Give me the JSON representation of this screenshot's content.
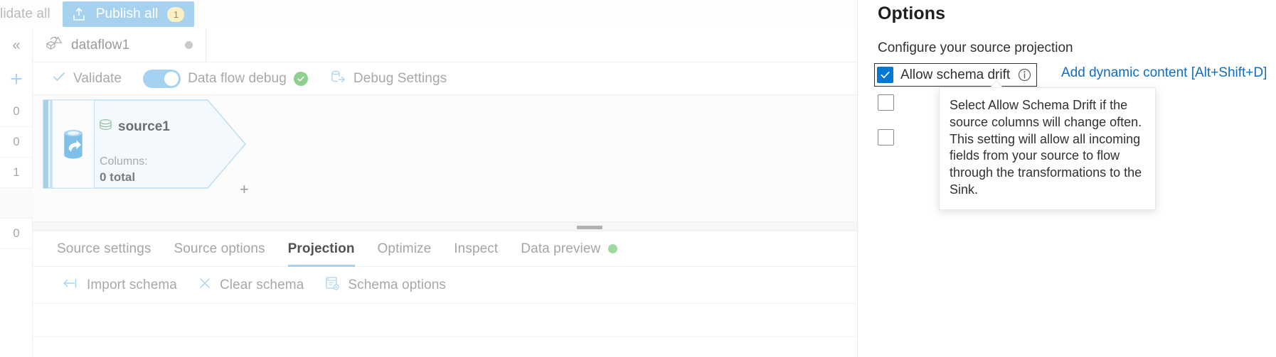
{
  "command_bar": {
    "validate_all_label": "lidate all",
    "publish_all_label": "Publish all",
    "publish_all_badge": "1",
    "publish_icon": "upload-icon"
  },
  "left_rail": {
    "collapse_icon": "chevron-double-left-icon",
    "add_icon": "plus-icon",
    "rows": [
      "0",
      "0",
      "1",
      "",
      "0",
      "",
      ""
    ]
  },
  "dataflow_tab": {
    "label": "dataflow1",
    "icon": "dataflow-icon",
    "status_dot": "unsaved-dot"
  },
  "action_bar": {
    "validate": {
      "label": "Validate",
      "icon": "checkmark-icon"
    },
    "data_flow_debug": {
      "label": "Data flow debug",
      "toggle_on": true,
      "status_icon": "success-check-icon"
    },
    "debug_settings": {
      "label": "Debug Settings",
      "icon": "debug-database-icon"
    }
  },
  "canvas": {
    "node": {
      "name": "source1",
      "source_icon": "dataset-stack-icon",
      "type_icon": "azure-source-icon",
      "columns_label": "Columns:",
      "columns_value": "0 total",
      "add_icon": "plus-icon"
    }
  },
  "bottom_tabs": {
    "items": [
      {
        "label": "Source settings",
        "active": false
      },
      {
        "label": "Source options",
        "active": false
      },
      {
        "label": "Projection",
        "active": true
      },
      {
        "label": "Optimize",
        "active": false
      },
      {
        "label": "Inspect",
        "active": false
      },
      {
        "label": "Data preview",
        "active": false,
        "dot": true
      }
    ]
  },
  "schema_toolbar": {
    "items": [
      {
        "label": "Import schema",
        "icon": "import-arrow-icon"
      },
      {
        "label": "Clear schema",
        "icon": "close-x-icon"
      },
      {
        "label": "Schema options",
        "icon": "schema-gear-icon"
      }
    ]
  },
  "options_panel": {
    "title": "Options",
    "subtitle": "Configure your source projection",
    "allow_schema_drift": {
      "label": "Allow schema drift",
      "checked": true,
      "info_icon": "info-circle-icon"
    },
    "dynamic_content_link": "Add dynamic content [Alt+Shift+D]",
    "checkbox_rows": [
      {
        "label": "",
        "checked": false
      },
      {
        "label": "",
        "checked": false
      }
    ],
    "tooltip": {
      "text": "Select Allow Schema Drift if the source columns will change often. This setting will allow all incoming fields from your source to flow through the transformations to the Sink."
    }
  },
  "colors": {
    "accent_blue": "#0078d4",
    "link_blue": "#0b6dc7",
    "publish_bg": "#a6d2f0",
    "badge_bg": "#fbf0c4",
    "success_green": "#8ed08e",
    "tab_underline": "#a6d3f2"
  }
}
